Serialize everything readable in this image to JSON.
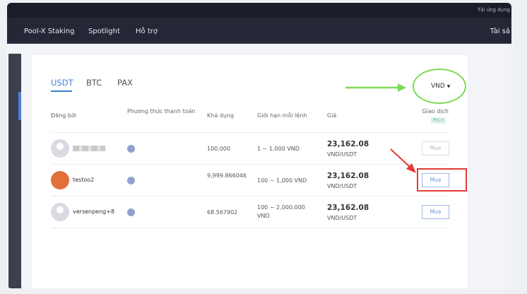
{
  "topbar": {
    "download_app": "Tải ứng dụng"
  },
  "nav": {
    "items": [
      "Pool-X Staking",
      "Spotlight",
      "Hỗ trợ"
    ],
    "right": "Tài sả"
  },
  "tabs": [
    "USDT",
    "BTC",
    "PAX"
  ],
  "currency": "VND",
  "headers": {
    "poster": "Đăng bởi",
    "payment": "Phương thức thanh toán",
    "available": "Khả dụng",
    "limit": "Giới hạn mỗi lệnh",
    "price": "Giá",
    "trade": "Giao dịch",
    "fee_badge": "Phí 0"
  },
  "rows": [
    {
      "name": "",
      "available": "100,000",
      "limit": "1 ~ 1,000 VND",
      "price": "23,162.08",
      "unit": "VND/USDT",
      "action": "Mua"
    },
    {
      "name": "testoo2",
      "available": "9,999.866046",
      "limit": "100 ~ 1,000 VND",
      "price": "23,162.08",
      "unit": "VND/USDT",
      "action": "Mua"
    },
    {
      "name": "versenpeng+8",
      "available": "68.567902",
      "limit": "100 ~ 2,000,000 VND",
      "price": "23,162.08",
      "unit": "VND/USDT",
      "action": "Mua"
    }
  ],
  "colors": {
    "accent": "#3f82d7",
    "annotation_green": "#7ed957",
    "annotation_red": "#e53935"
  }
}
